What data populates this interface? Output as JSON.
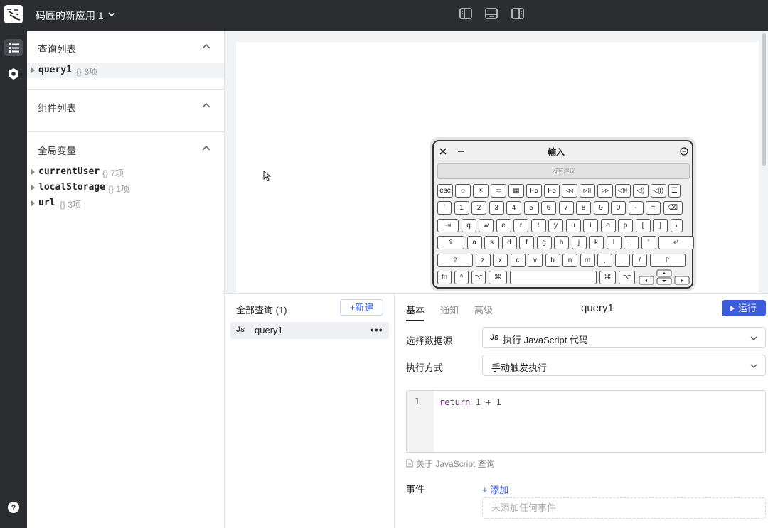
{
  "header": {
    "app_title": "码匠的新应用 1"
  },
  "explorer": {
    "sections": {
      "queries": {
        "title": "查询列表",
        "items": [
          {
            "name": "query1",
            "meta": "{} 8项"
          }
        ]
      },
      "components": {
        "title": "组件列表"
      },
      "globals": {
        "title": "全局变量",
        "items": [
          {
            "name": "currentUser",
            "meta": "{} 7项"
          },
          {
            "name": "localStorage",
            "meta": "{} 1项"
          },
          {
            "name": "url",
            "meta": "{} 3项"
          }
        ]
      }
    }
  },
  "keyboard": {
    "title": "輸入",
    "suggestion": "沒有建议",
    "rows": [
      [
        "esc",
        "☼",
        "☀",
        "▭",
        "▦",
        "F5",
        "F6",
        "◃◃",
        "▹॥",
        "▹▹",
        "◁×",
        "◁)",
        "◁))",
        "☰"
      ],
      [
        "`",
        "1",
        "2",
        "3",
        "4",
        "5",
        "6",
        "7",
        "8",
        "9",
        "0",
        "-",
        "=",
        "⌫"
      ],
      [
        "⇥",
        "q",
        "w",
        "e",
        "r",
        "t",
        "y",
        "u",
        "i",
        "o",
        "p",
        "[",
        "]",
        "\\"
      ],
      [
        "⇪",
        "a",
        "s",
        "d",
        "f",
        "g",
        "h",
        "j",
        "k",
        "l",
        ";",
        "'",
        "↵"
      ],
      [
        "⇧",
        "z",
        "x",
        "c",
        "v",
        "b",
        "n",
        "m",
        ",",
        ".",
        "/",
        "⇧"
      ],
      [
        "fn",
        "^",
        "⌥",
        "⌘",
        "",
        "⌘",
        "⌥"
      ]
    ]
  },
  "query_panel": {
    "title": "全部查询 (1)",
    "new_label": "+新建",
    "items": [
      {
        "name": "query1",
        "type_badge": "Js",
        "more": "•••"
      }
    ]
  },
  "editor": {
    "tabs": [
      "基本",
      "通知",
      "高级"
    ],
    "title": "query1",
    "run_label": "运行",
    "datasource_label": "选择数据源",
    "datasource_badge": "Js",
    "datasource_value": "执行 JavaScript 代码",
    "mode_label": "执行方式",
    "mode_value": "手动触发执行",
    "code": {
      "line_number": "1",
      "keyword": "return",
      "rest": " 1 + 1"
    },
    "about_link": "关于 JavaScript 查询",
    "events_label": "事件",
    "add_event": "+ 添加",
    "no_events": "未添加任何事件"
  },
  "colors": {
    "primary": "#3b5bdb",
    "sidebar": "#2b2d30",
    "canvas_bg": "#f2f3f5"
  }
}
